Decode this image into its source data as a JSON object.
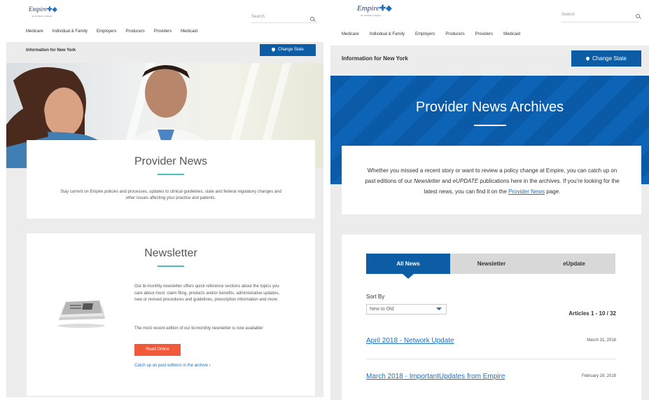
{
  "left": {
    "logo": {
      "name": "Empire",
      "tagline": "An Anthem Company"
    },
    "search": {
      "placeholder": "Search"
    },
    "nav": [
      "Medicare",
      "Individual & Family",
      "Employers",
      "Producers",
      "Providers",
      "Medicaid"
    ],
    "state": {
      "text": "Information for New York",
      "button": "Change State"
    },
    "provider_news": {
      "title": "Provider News",
      "description": "Stay current on Empire policies and processes, updates to clinical guidelines, state and federal regulatory changes and other issues affecting your practice and patients."
    },
    "newsletter": {
      "title": "Newsletter",
      "paragraph1": "Our bi-monthly newsletter offers quick reference sections about the topics you care about most: claim filing, products and/or benefits, administrative updates, new or revised procedures and guidelines, prescription information and more.",
      "paragraph2": "The most recent edition of our bi-monthly newsletter is now available!",
      "button": "Read Online",
      "archive_link": "Catch up on past editions in the archive",
      "archive_arrow": "›"
    }
  },
  "right": {
    "logo": {
      "name": "Empire",
      "tagline": "An Anthem Company"
    },
    "search": {
      "placeholder": "Search"
    },
    "nav": [
      "Medicare",
      "Individual & Family",
      "Employers",
      "Producers",
      "Providers",
      "Medicaid"
    ],
    "state": {
      "text": "Information for New York",
      "button": "Change State"
    },
    "banner_title": "Provider News Archives",
    "intro": {
      "part1": "Whether you missed a recent story or want to review a policy change at Empire, you can catch up on past editions of our ",
      "newsletter": "Newsletter",
      "and": " and ",
      "eupdate": "eUPDATE",
      "part2": " publications here in the archives. If you're looking for the latest news, you can find it on the ",
      "link": "Provider News",
      "part3": " page."
    },
    "tabs": [
      "All News",
      "Newsletter",
      "eUpdate"
    ],
    "sort": {
      "label": "Sort By",
      "selected": "New to Old"
    },
    "articles_count": "Articles 1 - 10 / 32",
    "articles": [
      {
        "title": "April 2018 - Network Update",
        "date": "March 31, 2018"
      },
      {
        "title": "March 2018 - ImportantUpdates from Empire",
        "date": "February 28, 2018"
      }
    ]
  },
  "colors": {
    "brand_blue": "#0d5ca6",
    "teal_rule": "#4bbfb5",
    "orange_button": "#f05a3a",
    "link_blue": "#1f6fc2"
  }
}
